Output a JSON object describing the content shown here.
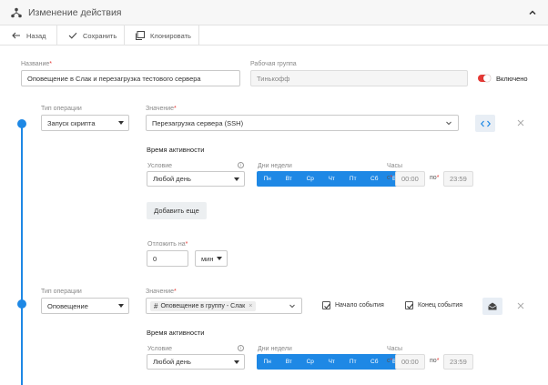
{
  "header": {
    "title": "Изменение действия"
  },
  "toolbar": {
    "back": "Назад",
    "save": "Сохранить",
    "clone": "Клонировать"
  },
  "form": {
    "name_label": "Название",
    "name_value": "Оповещение в Слак и перезагрузка тестового сервера",
    "group_label": "Рабочая группа",
    "group_value": "Тинькофф",
    "enabled_label": "Включено"
  },
  "op1": {
    "type_label": "Тип операции",
    "type_value": "Запуск скрипта",
    "value_label": "Значение",
    "value_value": "Перезагрузка сервера (SSH)",
    "activity_title": "Время активности",
    "condition_label": "Условие",
    "condition_value": "Любой день",
    "weekdays_label": "Дни недели",
    "days": [
      "Пн",
      "Вт",
      "Ср",
      "Чт",
      "Пт",
      "Сб",
      "Вс"
    ],
    "hours_label": "Часы",
    "from_label": "с",
    "from_value": "00:00",
    "to_label": "по",
    "to_value": "23:59",
    "add_more": "Добавить еще",
    "delay_label": "Отложить на",
    "delay_value": "0",
    "delay_unit": "мин"
  },
  "op2": {
    "type_label": "Тип операции",
    "type_value": "Оповещение",
    "value_label": "Значение",
    "tag_value": "Оповещение в группу - Слак",
    "tag_remove": "×",
    "event_start": "Начало события",
    "event_end": "Конец события",
    "activity_title": "Время активности",
    "condition_label": "Условие",
    "condition_value": "Любой день",
    "weekdays_label": "Дни недели",
    "days": [
      "Пн",
      "Вт",
      "Ср",
      "Чт",
      "Пт",
      "Сб",
      "Вс"
    ],
    "hours_label": "Часы",
    "from_label": "с",
    "from_value": "00:00",
    "to_label": "по",
    "to_value": "23:59"
  },
  "colors": {
    "accent": "#1e88e5",
    "toggle_on": "#e53935",
    "required": "#e53935"
  },
  "icons": [
    "workflow-icon",
    "chevron-up-icon",
    "arrow-left-icon",
    "check-icon",
    "copy-icon",
    "code-icon",
    "close-icon",
    "chevron-down-icon",
    "info-icon",
    "mail-icon"
  ]
}
